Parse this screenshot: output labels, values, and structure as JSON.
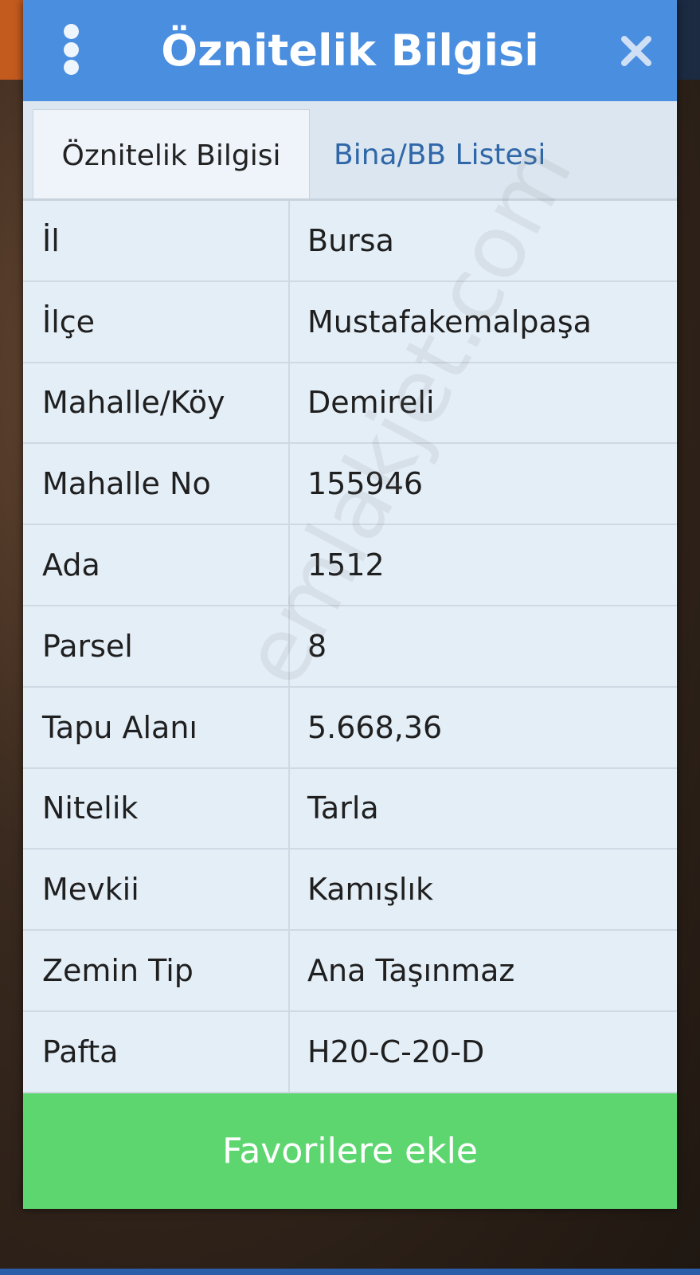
{
  "colors": {
    "header_bg": "#4a8ee0",
    "tab_active_text": "#222222",
    "tab_inactive_text": "#2f67a8",
    "row_bg": "#e4eef7",
    "button_bg": "#5ed670"
  },
  "header": {
    "title": "Öznitelik Bilgisi",
    "menu_icon": "more-vertical-icon",
    "close_icon": "close-icon"
  },
  "tabs": [
    {
      "label": "Öznitelik Bilgisi",
      "active": true
    },
    {
      "label": "Bina/BB Listesi",
      "active": false
    }
  ],
  "rows": [
    {
      "key": "İl",
      "value": "Bursa"
    },
    {
      "key": "İlçe",
      "value": "Mustafakemalpaşa"
    },
    {
      "key": "Mahalle/Köy",
      "value": "Demireli"
    },
    {
      "key": "Mahalle No",
      "value": "155946"
    },
    {
      "key": "Ada",
      "value": "1512"
    },
    {
      "key": "Parsel",
      "value": "8"
    },
    {
      "key": "Tapu Alanı",
      "value": "5.668,36"
    },
    {
      "key": "Nitelik",
      "value": "Tarla"
    },
    {
      "key": "Mevkii",
      "value": "Kamışlık"
    },
    {
      "key": "Zemin Tip",
      "value": "Ana Taşınmaz"
    },
    {
      "key": "Pafta",
      "value": "H20-C-20-D"
    }
  ],
  "button": {
    "label": "Favorilere ekle"
  },
  "watermark": "emlakjet.com"
}
